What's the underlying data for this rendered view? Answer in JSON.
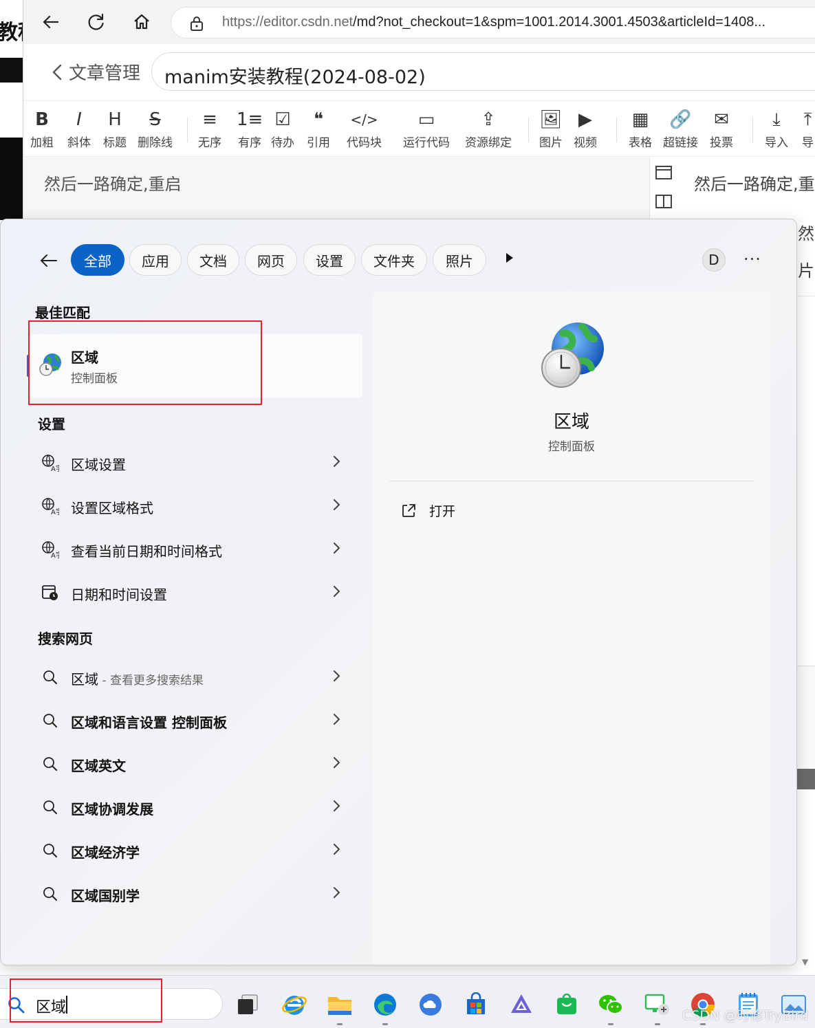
{
  "background": {
    "left_fragment": "教程",
    "right_fragment_1": "然后一路确定,重",
    "right_fragment_2": "片"
  },
  "browser": {
    "url_host": "https://editor.csdn.net",
    "url_path": "/md?not_checkout=1&spm=1001.2014.3001.4503&articleId=1408...",
    "icons": [
      "back-arrow-icon",
      "reload-icon",
      "home-icon",
      "lock-icon"
    ]
  },
  "editor": {
    "back_label": "文章管理",
    "article_title": "manim安装教程(2024-08-02)",
    "toolbar": [
      {
        "label": "加粗",
        "icon": "B"
      },
      {
        "label": "斜体",
        "icon": "I"
      },
      {
        "label": "标题",
        "icon": "H"
      },
      {
        "label": "删除线",
        "icon": "S"
      },
      {
        "label": "无序",
        "icon": "≡"
      },
      {
        "label": "有序",
        "icon": "1≡"
      },
      {
        "label": "待办",
        "icon": "☑"
      },
      {
        "label": "引用",
        "icon": "❝"
      },
      {
        "label": "代码块",
        "icon": "</>"
      },
      {
        "label": "运行代码",
        "icon": "▭"
      },
      {
        "label": "资源绑定",
        "icon": "⇪"
      },
      {
        "label": "图片",
        "icon": "🖼"
      },
      {
        "label": "视频",
        "icon": "▶"
      },
      {
        "label": "表格",
        "icon": "▦"
      },
      {
        "label": "超链接",
        "icon": "🔗"
      },
      {
        "label": "投票",
        "icon": "✉"
      },
      {
        "label": "导入",
        "icon": "⤓"
      },
      {
        "label": "导",
        "icon": "⤒"
      }
    ],
    "body_text": "然后一路确定,重启",
    "preview_text": "然后一路确定,重"
  },
  "search": {
    "filters": [
      "全部",
      "应用",
      "文档",
      "网页",
      "设置",
      "文件夹",
      "照片"
    ],
    "active_filter": "全部",
    "user_initial": "D",
    "more_label": "···",
    "best_match_title": "最佳匹配",
    "best_match": {
      "name": "区域",
      "subtitle": "控制面板"
    },
    "settings_title": "设置",
    "settings_items": [
      "区域设置",
      "设置区域格式",
      "查看当前日期和时间格式",
      "日期和时间设置"
    ],
    "web_title": "搜索网页",
    "web_items": [
      {
        "bold": "区域",
        "rest": "",
        "hint": " - 查看更多搜索结果"
      },
      {
        "bold": "",
        "rest": "区域和语言设置 控制面板",
        "hint": ""
      },
      {
        "bold": "",
        "rest": "区域英文",
        "hint": ""
      },
      {
        "bold": "",
        "rest": "区域协调发展",
        "hint": ""
      },
      {
        "bold": "",
        "rest": "区域经济学",
        "hint": ""
      },
      {
        "bold": "",
        "rest": "区域国别学",
        "hint": ""
      }
    ],
    "detail": {
      "name": "区域",
      "subtitle": "控制面板",
      "action": "打开"
    }
  },
  "taskbar": {
    "search_value": "区域",
    "apps": [
      "task-view-icon",
      "ie-icon",
      "file-explorer-icon",
      "edge-icon",
      "cloud-icon",
      "store-icon",
      "vs-icon",
      "bag-icon",
      "wechat-icon",
      "remote-icon",
      "chrome-icon",
      "notepad-icon",
      "photos-icon"
    ]
  },
  "watermark": "CSDN @时修TryBird",
  "colors": {
    "accent": "#0b63c7",
    "highlight_box": "#e0232f",
    "selection_accent": "#6b4ea8"
  }
}
